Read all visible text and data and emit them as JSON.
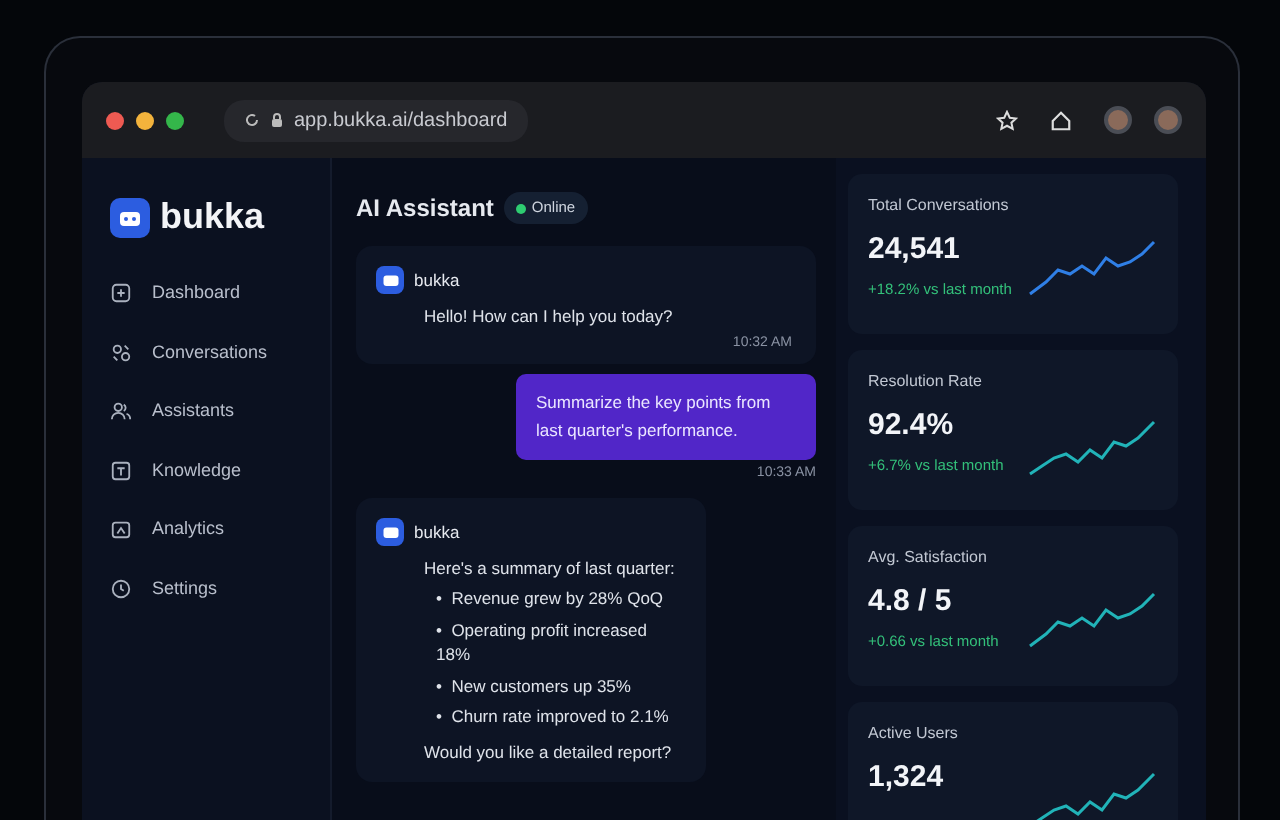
{
  "browser": {
    "url": "app.bukka.ai/dashboard"
  },
  "sidebar": {
    "brand": "bukka",
    "items": [
      {
        "label": "Dashboard"
      },
      {
        "label": "Conversations"
      },
      {
        "label": "Assistants"
      },
      {
        "label": "Knowledge"
      },
      {
        "label": "Analytics"
      },
      {
        "label": "Settings"
      }
    ]
  },
  "chat": {
    "title": "AI Assistant",
    "status": "Online",
    "messages": [
      {
        "kind": "bot",
        "sender": "bukka",
        "text": "Hello! How can I help you today?",
        "time": "10:32 AM"
      },
      {
        "kind": "user",
        "text": "Summarize the key points from last quarter's performance.",
        "time": "10:33 AM"
      },
      {
        "kind": "bot",
        "sender": "bukka",
        "text": "Here's a summary of last quarter:",
        "bullets": [
          {
            "marker": "•",
            "text": "Revenue grew by 28% QoQ"
          },
          {
            "marker": "•",
            "text": "Operating profit increased 18%"
          },
          {
            "marker": "•",
            "text": "New customers up 35%"
          },
          {
            "marker": "•",
            "text": "Churn rate improved to 2.1%"
          }
        ],
        "closing": "Would you like a detailed report?"
      }
    ]
  },
  "stats": [
    {
      "label": "Total Conversations",
      "value": "24,541",
      "change": "+18.2% vs last month",
      "color": "#2f7fe6"
    },
    {
      "label": "Resolution Rate",
      "value": "92.4%",
      "change": "+6.7% vs last month",
      "color": "#21b3b8"
    },
    {
      "label": "Avg. Satisfaction",
      "value": "4.8 / 5",
      "change": "+0.66 vs last month",
      "color": "#21b3b8"
    },
    {
      "label": "Active Users",
      "value": "1,324",
      "color": "#21b3b8"
    }
  ]
}
